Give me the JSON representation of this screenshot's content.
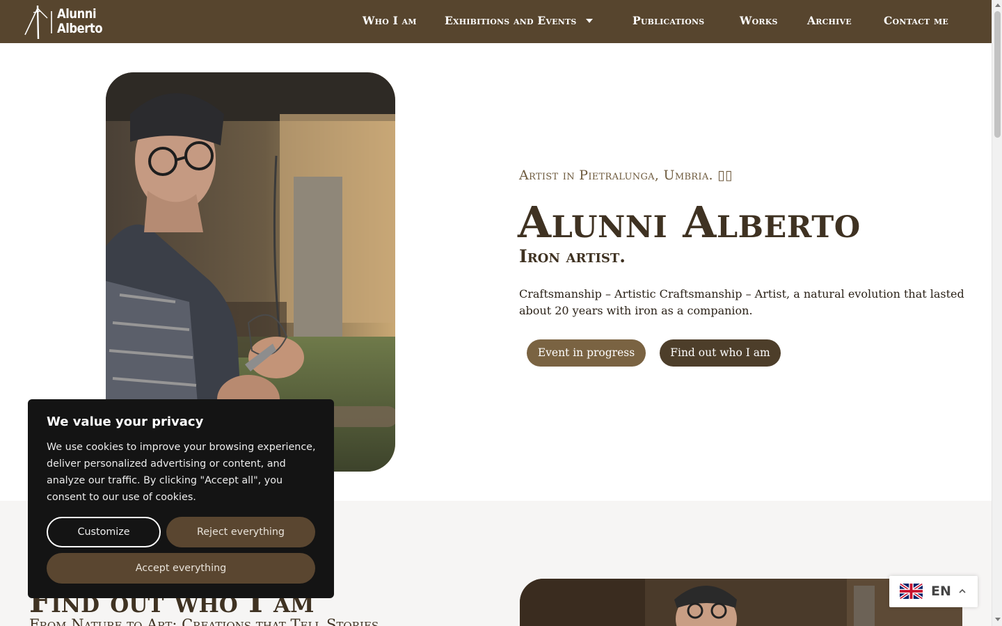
{
  "header": {
    "logo_line1": "Alunni",
    "logo_line2": "Alberto",
    "nav": [
      {
        "label": "Who I am"
      },
      {
        "label": "Exhibitions and Events"
      },
      {
        "label": "Publications"
      },
      {
        "label": "Works"
      },
      {
        "label": "Archive"
      },
      {
        "label": "Contact me"
      }
    ]
  },
  "hero": {
    "subtitle": "Artist in Pietralunga, Umbria. ▯▯",
    "title": "Alunni Alberto",
    "role": "Iron artist.",
    "description": "Craftsmanship – Artistic Craftsmanship – Artist, a natural evolution that lasted about 20 years with iron as a companion.",
    "buttons": {
      "event": "Event in progress",
      "who": "Find out who I am"
    }
  },
  "section2": {
    "title": "Find out who I am",
    "subtitle": "From Nature to Art: Creations that Tell Stories"
  },
  "cookie": {
    "title": "We value your privacy",
    "text": "We use cookies to improve your browsing experience, deliver personalized advertising or content, and analyze our traffic. By clicking \"Accept all\", you consent to our use of cookies.",
    "customize": "Customize",
    "reject": "Reject everything",
    "accept": "Accept everything"
  },
  "language": {
    "code": "EN",
    "flag": "uk-flag-icon"
  },
  "colors": {
    "header_bg": "#57452e",
    "button_primary": "#7a6342",
    "button_dark": "#4d3e2a",
    "cookie_bg": "#141414"
  }
}
